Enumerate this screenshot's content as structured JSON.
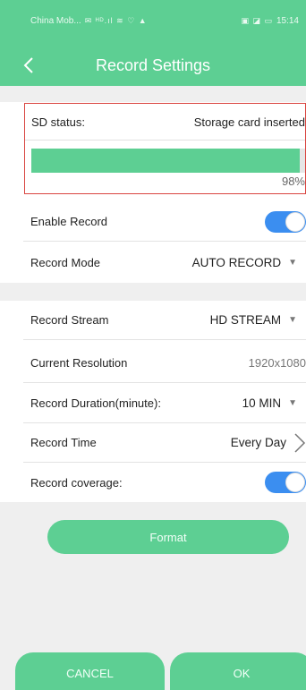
{
  "status_bar": {
    "carrier": "China Mob...",
    "signal_icons": "✉ ᴴᴰ.ıl ≋ ♡ ▲",
    "right_icons": "▣ ◪ ▭",
    "time": "15:14"
  },
  "header": {
    "title": "Record Settings",
    "back_icon": "back-arrow-icon"
  },
  "colors": {
    "accent": "#5dcf93",
    "toggle": "#3b8ef0",
    "highlight": "#d9443f"
  },
  "sd_card": {
    "label": "SD status:",
    "value": "Storage card inserted",
    "usage_percent": 98,
    "usage_label": "98%"
  },
  "settings": {
    "enable_record": {
      "label": "Enable Record",
      "on": true
    },
    "record_mode": {
      "label": "Record Mode",
      "value": "AUTO RECORD"
    },
    "record_stream": {
      "label": "Record Stream",
      "value": "HD STREAM"
    },
    "current_resolution": {
      "label": "Current Resolution",
      "value": "1920x1080"
    },
    "record_duration": {
      "label": "Record Duration(minute):",
      "value": "10 MIN"
    },
    "record_time": {
      "label": "Record Time",
      "value": "Every Day"
    },
    "record_coverage": {
      "label": "Record coverage:",
      "on": true
    }
  },
  "buttons": {
    "format": "Format",
    "cancel": "CANCEL",
    "ok": "OK"
  }
}
